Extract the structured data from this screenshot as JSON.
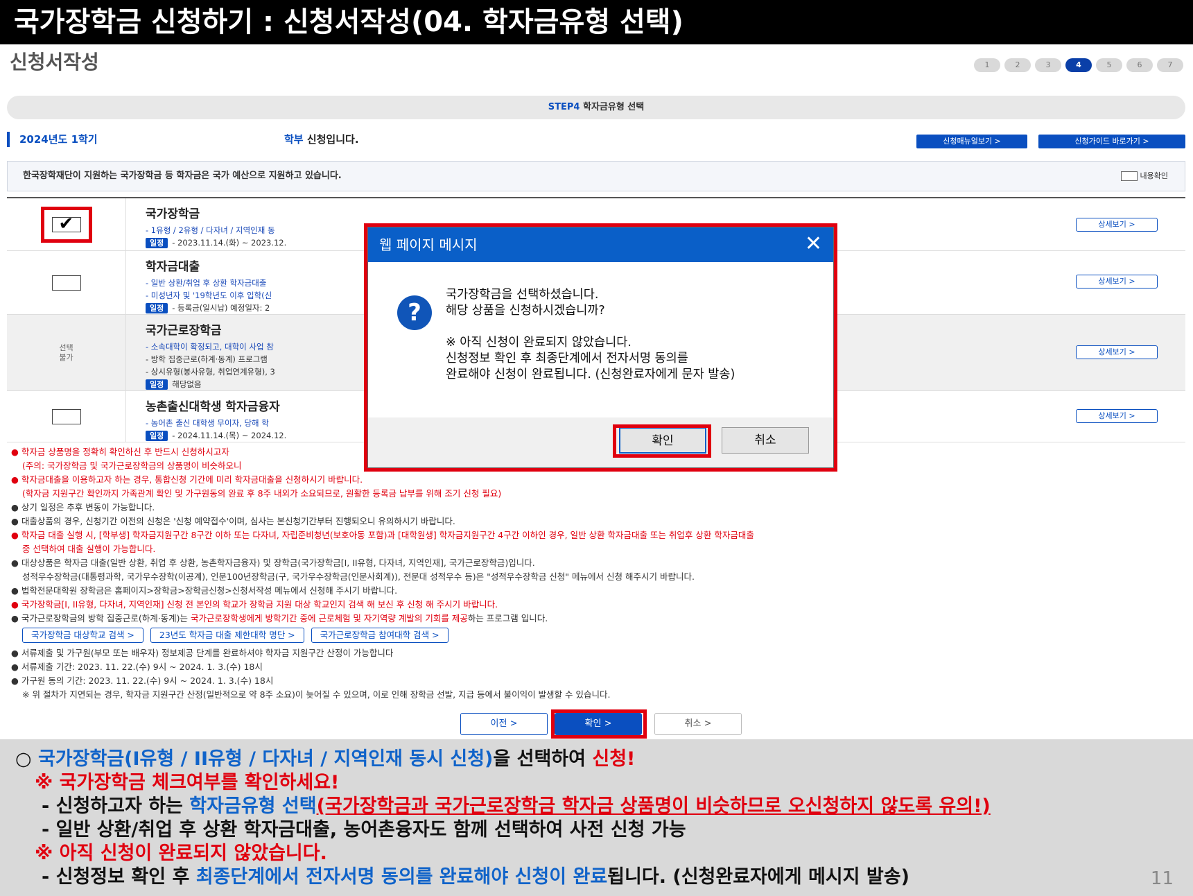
{
  "header": {
    "title": "국가장학금 신청하기 : 신청서작성(04. 학자금유형 선택)",
    "page_heading": "신청서작성"
  },
  "steps": [
    "1",
    "2",
    "3",
    "4",
    "5",
    "6",
    "7"
  ],
  "step_banner": {
    "code": "STEP4",
    "label": "학자금유형 선택"
  },
  "term": "2024년도 1학기",
  "applicant_type": {
    "highlight": "학부",
    "rest": " 신청입니다."
  },
  "top_buttons": {
    "manual": "신청매뉴얼보기 >",
    "guide": "신청가이드 바로가기 >"
  },
  "notice": {
    "text": "한국장학재단이 지원하는 국가장학금 등 학자금은 국가 예산으로 지원하고 있습니다.",
    "confirm_label": "내용확인"
  },
  "products": [
    {
      "name": "국가장학금",
      "lines": [
        "- 1유형 / 2유형 / 다자녀 / 지역인재 동"
      ],
      "schedule_label": "일정",
      "schedule": "- 2023.11.14.(화) ~ 2023.12.",
      "detail": "상세보기 >",
      "state": "checked"
    },
    {
      "name": "학자금대출",
      "lines": [
        "- 일반 상환/취업 후 상환 학자금대출",
        "- 미성년자 및 '19학년도 이후 입학(신"
      ],
      "schedule_label": "일정",
      "schedule": "- 등록금(일시납) 예정일자: 2",
      "detail": "상세보기 >",
      "state": "unchecked"
    },
    {
      "name": "국가근로장학금",
      "lines": [
        "- 소속대학이 확정되고, 대학이 사업 참",
        "- 방학 집중근로(하계·동계) 프로그램",
        "- 상시유형(봉사유형, 취업연계유형), 3"
      ],
      "schedule_label": "일정",
      "schedule": "해당없음",
      "detail": "상세보기 >",
      "state": "unavailable",
      "unavailable_label": "선택\n불가"
    },
    {
      "name": "농촌출신대학생 학자금융자",
      "lines": [
        "- 농어촌 출신 대학생 무이자, 당해 학"
      ],
      "schedule_label": "일정",
      "schedule": "- 2024.11.14.(목) ~ 2024.12.",
      "detail": "상세보기 >",
      "state": "unchecked"
    }
  ],
  "notes": [
    {
      "text": "● 학자금 상품명을 정확히 확인하신 후 반드시 신청하시고자",
      "red": true
    },
    {
      "text": "(주의: 국가장학금 및 국가근로장학금의 상품명이 비슷하오니",
      "red": true,
      "indent": true
    },
    {
      "text": "● 학자금대출을 이용하고자 하는 경우, 통합신청 기간에 미리 학자금대출을 신청하시기 바랍니다.",
      "red": true
    },
    {
      "text": "(학자금 지원구간 확인까지 가족관계 확인 및 가구원동의 완료 후 8주 내외가 소요되므로, 원활한 등록금 납부를 위해 조기 신청 필요)",
      "red": true,
      "indent": true
    },
    {
      "text": "● 상기 일정은 추후 변동이 가능합니다."
    },
    {
      "text": "● 대출상품의 경우, 신청기간 이전의 신청은 '신청 예약접수'이며, 심사는 본신청기간부터 진행되오니 유의하시기 바랍니다."
    },
    {
      "text": "● 학자금 대출 실행 시, [학부생] 학자금지원구간 8구간 이하 또는 다자녀, 자립준비청년(보호아동 포함)과 [대학원생] 학자금지원구간 4구간 이하인 경우, 일반 상환 학자금대출 또는 취업후 상환 학자금대출",
      "red": true
    },
    {
      "text": "중 선택하여 대출 실행이 가능합니다.",
      "red": true,
      "indent": true
    },
    {
      "text": "● 대상상품은 학자금 대출(일반 상환, 취업 후 상환, 농촌학자금융자) 및 장학금(국가장학금[I, II유형, 다자녀, 지역인재], 국가근로장학금)입니다."
    },
    {
      "text": "성적우수장학금(대통령과학, 국가우수장학(이공계), 인문100년장학금(구, 국가우수장학금(인문사회계)), 전문대 성적우수 등)은 \"성적우수장학금 신청\" 메뉴에서 신청 해주시기 바랍니다.",
      "indent": true
    },
    {
      "text": "● 법학전문대학원 장학금은 홈페이지>장학금>장학금신청>신청서작성 메뉴에서 신청해 주시기 바랍니다."
    },
    {
      "text": "● 국가장학금[I, II유형, 다자녀, 지역인재] 신청 전 본인의 학교가 장학금 지원 대상 학교인지 검색 해 보신 후 신청 해 주시기 바랍니다.",
      "red": true
    },
    {
      "text_before": "● 국가근로장학금의 방학 집중근로(하계·동계)는 ",
      "text_red": "국가근로장학생에게 방학기간 중에 근로체험 및 자기역량 계발의 기회를 제공",
      "text_after": "하는 프로그램 입니다.",
      "mixed": true
    }
  ],
  "link_buttons": [
    "국가장학금 대상학교 검색 >",
    "23년도 학자금 대출 제한대학 명단 >",
    "국가근로장학금 참여대학 검색 >"
  ],
  "notes2": [
    "● 서류제출 및 가구원(부모 또는 배우자) 정보제공 단계를 완료하셔야 학자금 지원구간 산정이 가능합니다",
    "● 서류제출 기간: 2023. 11. 22.(수) 9시 ~ 2024. 1. 3.(수) 18시",
    "● 가구원 동의 기간: 2023. 11. 22.(수) 9시 ~ 2024. 1. 3.(수) 18시",
    "※ 위 절차가 지연되는 경우, 학자금 지원구간 산정(일반적으로 약 8주 소요)이 늦어질 수 있으며, 이로 인해 장학금 선발, 지급 등에서 불이익이 발생할 수 있습니다."
  ],
  "bottom_buttons": {
    "prev": "이전 >",
    "ok": "확인 >",
    "cancel": "취소 >"
  },
  "dialog": {
    "title": "웹 페이지 메시지",
    "close": "✕",
    "icon": "?",
    "message": [
      "국가장학금을 선택하셨습니다.",
      "해당 상품을 신청하시겠습니까?",
      "",
      "※ 아직 신청이 완료되지 않았습니다.",
      "신청정보 확인 후 최종단계에서 전자서명 동의를",
      "완료해야 신청이 완료됩니다. (신청완료자에게 문자 발송)"
    ],
    "ok": "확인",
    "cancel": "취소"
  },
  "explanation": {
    "l1_prefix": "○ ",
    "l1_blue": "국가장학금(I유형 / II유형 / 다자녀 / 지역인재 동시 신청)",
    "l1_mid": "을 선택하여 ",
    "l1_red": "신청!",
    "l2": "※ 국가장학금 체크여부를 확인하세요!",
    "l3_prefix": "- 신청하고자 하는 ",
    "l3_blue": "학자금유형 선택",
    "l3_red": "(국가장학금과 국가근로장학금 학자금 상품명이 비슷하므로 오신청하지 않도록 유의!)",
    "l4": "- 일반 상환/취업 후 상환 학자금대출, 농어촌융자도 함께 선택하여 사전 신청 가능",
    "l5": "※ 아직 신청이 완료되지 않았습니다.",
    "l6_prefix": "- 신청정보 확인 후 ",
    "l6_blue": "최종단계에서 전자서명 동의를 완료해야 신청이 완료",
    "l6_suffix": "됩니다. (신청완료자에게 메시지 발송)"
  },
  "page_number": "11"
}
